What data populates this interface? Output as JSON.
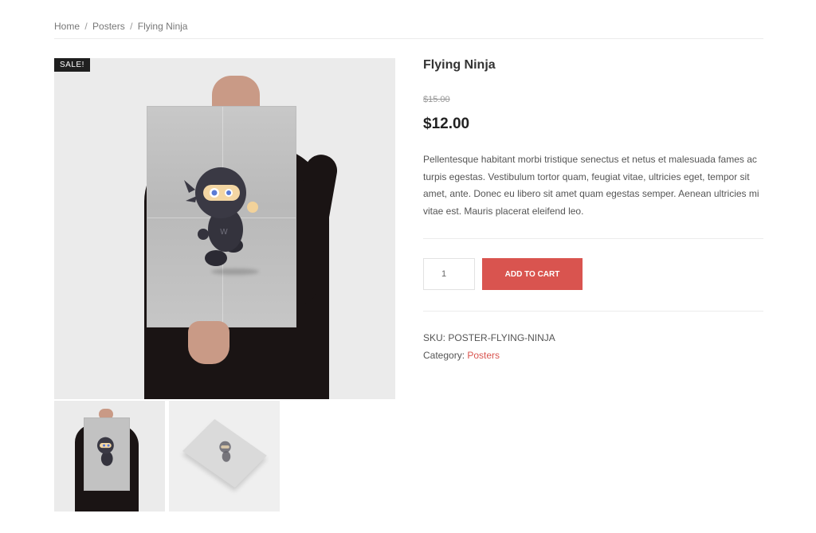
{
  "breadcrumb": {
    "home": "Home",
    "separator": "/",
    "category": "Posters",
    "current": "Flying Ninja"
  },
  "gallery": {
    "sale_badge": "SALE!",
    "thumbnails": [
      "poster-held",
      "poster-flat"
    ]
  },
  "product": {
    "title": "Flying Ninja",
    "old_price": "$15.00",
    "price": "$12.00",
    "description": "Pellentesque habitant morbi tristique senectus et netus et malesuada fames ac turpis egestas. Vestibulum tortor quam, feugiat vitae, ultricies eget, tempor sit amet, ante. Donec eu libero sit amet quam egestas semper. Aenean ultricies mi vitae est. Mauris placerat eleifend leo.",
    "quantity": "1",
    "add_to_cart_label": "ADD TO CART",
    "sku_label": "SKU:",
    "sku": "POSTER-FLYING-NINJA",
    "category_label": "Category:",
    "category": "Posters"
  },
  "colors": {
    "accent": "#d9544f",
    "badge": "#1f1f1f",
    "text": "#555555"
  }
}
